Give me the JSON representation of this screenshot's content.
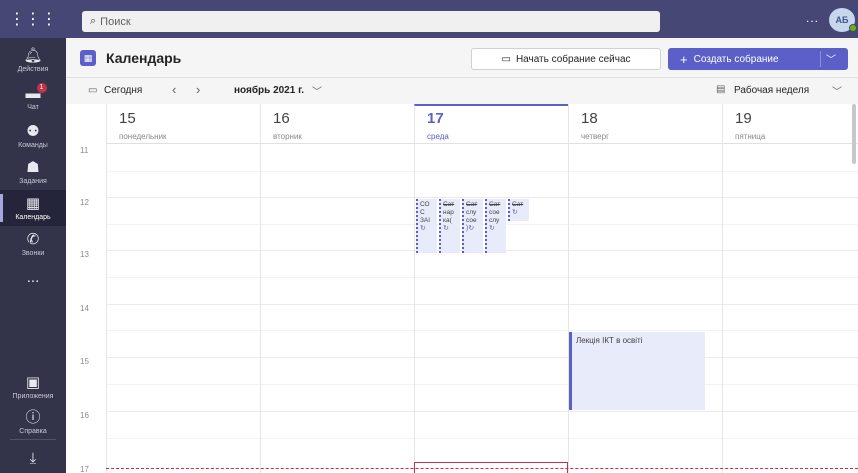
{
  "topbar": {
    "apps_icon": "grid-icon",
    "search_placeholder": "Поиск",
    "more": "...",
    "avatar_initials": "АБ"
  },
  "rail": {
    "items": [
      {
        "label": "Действия",
        "icon": "bell-icon"
      },
      {
        "label": "Чат",
        "icon": "chat-icon",
        "badge": "1"
      },
      {
        "label": "Команды",
        "icon": "teams-icon"
      },
      {
        "label": "Задания",
        "icon": "assignments-icon"
      },
      {
        "label": "Календарь",
        "icon": "calendar-icon",
        "active": true
      },
      {
        "label": "Звонки",
        "icon": "phone-icon"
      },
      {
        "label": "...",
        "icon": "more-icon"
      },
      {
        "label": "Приложения",
        "icon": "apps-icon"
      },
      {
        "label": "Справка",
        "icon": "help-icon"
      },
      {
        "label": "",
        "icon": "download-icon"
      }
    ]
  },
  "header": {
    "title": "Календарь",
    "meet_now_label": "Начать собрание сейчас",
    "create_label": "Создать собрание"
  },
  "toolbar": {
    "today_label": "Сегодня",
    "month_label": "ноябрь 2021 г.",
    "view_label": "Рабочая неделя"
  },
  "days": [
    {
      "num": "15",
      "name": "понедельник",
      "today": false
    },
    {
      "num": "16",
      "name": "вторник",
      "today": false
    },
    {
      "num": "17",
      "name": "среда",
      "today": true
    },
    {
      "num": "18",
      "name": "четверг",
      "today": false
    },
    {
      "num": "19",
      "name": "пятница",
      "today": false
    }
  ],
  "hours": [
    "11",
    "12",
    "13",
    "14",
    "15",
    "16",
    "17"
  ],
  "mini_events": [
    {
      "lines": [
        "СО",
        "С",
        "ЗАІ"
      ],
      "repeat": "↻"
    },
    {
      "lines": [
        "Сат",
        "нар",
        "ка("
      ],
      "repeat": "↻"
    },
    {
      "lines": [
        "Сат",
        "слу",
        "сое"
      ],
      "repeat": ")↻"
    },
    {
      "lines": [
        "Сат",
        "сое",
        "слу"
      ],
      "repeat": "↻"
    },
    {
      "lines": [
        "Сат"
      ],
      "repeat": "↻"
    }
  ],
  "lecture_event": {
    "title": "Лекція ІКТ в освіті"
  }
}
